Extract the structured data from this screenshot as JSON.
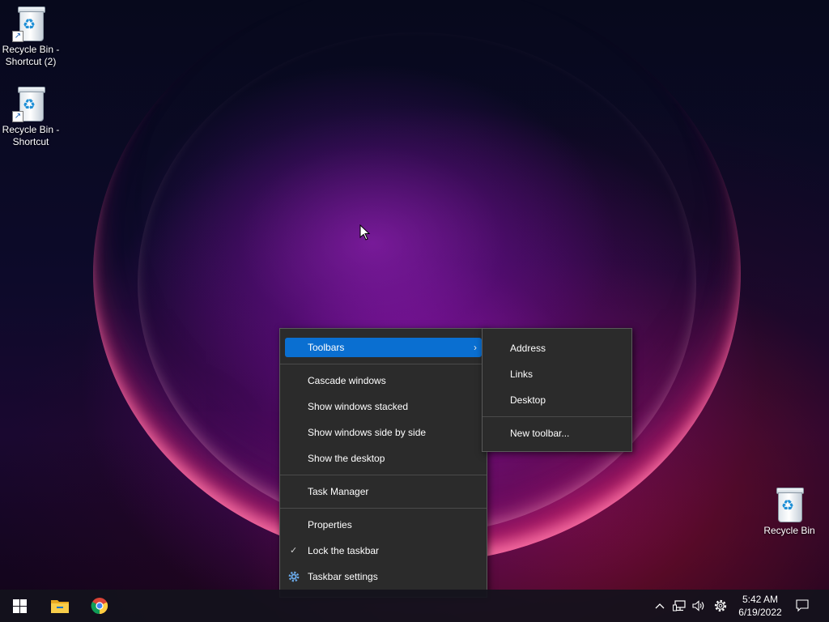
{
  "desktop": {
    "icons": [
      {
        "label": "Recycle Bin -\nShortcut (2)",
        "line1": "Recycle Bin -",
        "line2": "Shortcut (2)"
      },
      {
        "label": "Recycle Bin -\nShortcut",
        "line1": "Recycle Bin -",
        "line2": "Shortcut"
      },
      {
        "label": "Recycle Bin",
        "line1": "Recycle Bin"
      }
    ]
  },
  "context_menu": {
    "toolbars": "Toolbars",
    "cascade": "Cascade windows",
    "stacked": "Show windows stacked",
    "side_by_side": "Show windows side by side",
    "show_desktop": "Show the desktop",
    "task_manager": "Task Manager",
    "properties": "Properties",
    "lock_taskbar": "Lock the taskbar",
    "lock_taskbar_checked": true,
    "taskbar_settings": "Taskbar settings"
  },
  "toolbars_submenu": {
    "address": "Address",
    "links": "Links",
    "desktop": "Desktop",
    "new_toolbar": "New toolbar..."
  },
  "taskbar": {
    "pinned": [
      "start-icon",
      "file-explorer-icon",
      "chrome-icon"
    ],
    "tray_icons": [
      "chevron-up-icon",
      "network-icon",
      "volume-icon",
      "gear-icon"
    ],
    "time": "5:42 AM",
    "date": "6/19/2022"
  },
  "colors": {
    "menu_bg": "#2b2b2b",
    "highlight": "#0a6fd1",
    "taskbar_bg": "#14121c"
  }
}
